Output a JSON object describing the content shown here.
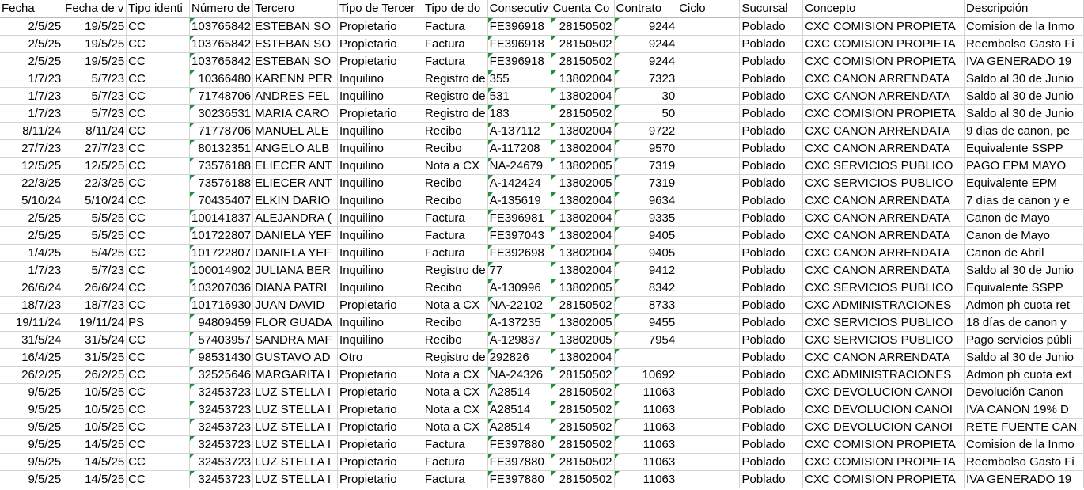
{
  "headers": [
    "Fecha",
    "Fecha de v",
    "Tipo identi",
    "Número de",
    "Tercero",
    "Tipo de Tercer",
    "Tipo de do",
    "Consecutiv",
    "Cuenta Co",
    "Contrato",
    "Ciclo",
    "Sucursal",
    "Concepto",
    "Descripción"
  ],
  "rows": [
    [
      "2/5/25",
      "19/5/25",
      "CC",
      "103765842",
      "ESTEBAN SO",
      "Propietario",
      "Factura",
      "FE396918",
      "28150502",
      "9244",
      "",
      "Poblado",
      "CXC COMISION PROPIETA",
      "Comision de la Inmo"
    ],
    [
      "2/5/25",
      "19/5/25",
      "CC",
      "103765842",
      "ESTEBAN SO",
      "Propietario",
      "Factura",
      "FE396918",
      "28150502",
      "9244",
      "",
      "Poblado",
      "CXC COMISION PROPIETA",
      "Reembolso Gasto Fi"
    ],
    [
      "2/5/25",
      "19/5/25",
      "CC",
      "103765842",
      "ESTEBAN SO",
      "Propietario",
      "Factura",
      "FE396918",
      "28150502",
      "9244",
      "",
      "Poblado",
      "CXC COMISION PROPIETA",
      "IVA GENERADO 19"
    ],
    [
      "1/7/23",
      "5/7/23",
      "CC",
      "10366480",
      "KARENN PER",
      "Inquilino",
      "Registro de",
      "355",
      "13802004",
      "7323",
      "",
      "Poblado",
      "CXC CANON ARRENDATA",
      "Saldo al 30 de Junio"
    ],
    [
      "1/7/23",
      "5/7/23",
      "CC",
      "71748706",
      "ANDRES FEL",
      "Inquilino",
      "Registro de",
      "531",
      "13802004",
      "30",
      "",
      "Poblado",
      "CXC CANON ARRENDATA",
      "Saldo al 30 de Junio"
    ],
    [
      "1/7/23",
      "5/7/23",
      "CC",
      "30236531",
      "MARIA CARO",
      "Propietario",
      "Registro de",
      "183",
      "28150502",
      "50",
      "",
      "Poblado",
      "CXC COMISION PROPIETA",
      "Saldo al 30 de Junio"
    ],
    [
      "8/11/24",
      "8/11/24",
      "CC",
      "71778706",
      "MANUEL ALE",
      "Inquilino",
      "Recibo",
      "A-137112",
      "13802004",
      "9722",
      "",
      "Poblado",
      "CXC CANON ARRENDATA",
      "9 dias de canon, pe"
    ],
    [
      "27/7/23",
      "27/7/23",
      "CC",
      "80132351",
      "ANGELO ALB",
      "Inquilino",
      "Recibo",
      "A-117208",
      "13802004",
      "9570",
      "",
      "Poblado",
      "CXC CANON ARRENDATA",
      "Equivalente SSPP"
    ],
    [
      "12/5/25",
      "12/5/25",
      "CC",
      "73576188",
      "ELIECER ANT",
      "Inquilino",
      "Nota a CX",
      "NA-24679",
      "13802005",
      "7319",
      "",
      "Poblado",
      "CXC SERVICIOS PUBLICO",
      "PAGO EPM MAYO"
    ],
    [
      "22/3/25",
      "22/3/25",
      "CC",
      "73576188",
      "ELIECER ANT",
      "Inquilino",
      "Recibo",
      "A-142424",
      "13802005",
      "7319",
      "",
      "Poblado",
      "CXC SERVICIOS PUBLICO",
      "Equivalente EPM"
    ],
    [
      "5/10/24",
      "5/10/24",
      "CC",
      "70435407",
      "ELKIN DARIO",
      "Inquilino",
      "Recibo",
      "A-135619",
      "13802004",
      "9634",
      "",
      "Poblado",
      "CXC CANON ARRENDATA",
      "7 días de canon y e"
    ],
    [
      "2/5/25",
      "5/5/25",
      "CC",
      "100141837",
      "ALEJANDRA (",
      "Inquilino",
      "Factura",
      "FE396981",
      "13802004",
      "9335",
      "",
      "Poblado",
      "CXC CANON ARRENDATA",
      "Canon  de Mayo"
    ],
    [
      "2/5/25",
      "5/5/25",
      "CC",
      "101722807",
      "DANIELA YEF",
      "Inquilino",
      "Factura",
      "FE397043",
      "13802004",
      "9405",
      "",
      "Poblado",
      "CXC CANON ARRENDATA",
      "Canon  de Mayo"
    ],
    [
      "1/4/25",
      "5/4/25",
      "CC",
      "101722807",
      "DANIELA YEF",
      "Inquilino",
      "Factura",
      "FE392698",
      "13802004",
      "9405",
      "",
      "Poblado",
      "CXC CANON ARRENDATA",
      "Canon  de Abril"
    ],
    [
      "1/7/23",
      "5/7/23",
      "CC",
      "100014902",
      "JULIANA BER",
      "Inquilino",
      "Registro de",
      "77",
      "13802004",
      "9412",
      "",
      "Poblado",
      "CXC CANON ARRENDATA",
      "Saldo al 30 de Junio"
    ],
    [
      "26/6/24",
      "26/6/24",
      "CC",
      "103207036",
      "DIANA PATRI",
      "Inquilino",
      "Recibo",
      "A-130996",
      "13802005",
      "8342",
      "",
      "Poblado",
      "CXC SERVICIOS PUBLICO",
      "Equivalente SSPP"
    ],
    [
      "18/7/23",
      "18/7/23",
      "CC",
      "101716930",
      "JUAN DAVID",
      "Propietario",
      "Nota a CX",
      "NA-22102",
      "28150502",
      "8733",
      "",
      "Poblado",
      "CXC ADMINISTRACIONES",
      "Admon ph cuota ret"
    ],
    [
      "19/11/24",
      "19/11/24",
      "PS",
      "94809459",
      "FLOR GUADA",
      "Inquilino",
      "Recibo",
      "A-137235",
      "13802005",
      "9455",
      "",
      "Poblado",
      "CXC SERVICIOS PUBLICO",
      "18 días de canon y"
    ],
    [
      "31/5/24",
      "31/5/24",
      "CC",
      "57403957",
      "SANDRA MAF",
      "Inquilino",
      "Recibo",
      "A-129837",
      "13802005",
      "7954",
      "",
      "Poblado",
      "CXC SERVICIOS PUBLICO",
      "Pago servicios públi"
    ],
    [
      "16/4/25",
      "31/5/25",
      "CC",
      "98531430",
      "GUSTAVO AD",
      "Otro",
      "Registro de",
      "292826",
      "13802004",
      "",
      "",
      "Poblado",
      "CXC CANON ARRENDATA",
      "Saldo al 30 de Junio"
    ],
    [
      "26/2/25",
      "26/2/25",
      "CC",
      "32525646",
      "MARGARITA I",
      "Propietario",
      "Nota a CX",
      "NA-24326",
      "28150502",
      "10692",
      "",
      "Poblado",
      "CXC ADMINISTRACIONES",
      "Admon ph cuota ext"
    ],
    [
      "9/5/25",
      "10/5/25",
      "CC",
      "32453723",
      "LUZ STELLA I",
      "Propietario",
      "Nota a CX",
      "A28514",
      "28150502",
      "11063",
      "",
      "Poblado",
      "CXC DEVOLUCION CANOI",
      "Devolución Canon"
    ],
    [
      "9/5/25",
      "10/5/25",
      "CC",
      "32453723",
      "LUZ STELLA I",
      "Propietario",
      "Nota a CX",
      "A28514",
      "28150502",
      "11063",
      "",
      "Poblado",
      "CXC DEVOLUCION CANOI",
      "IVA CANON 19% D"
    ],
    [
      "9/5/25",
      "10/5/25",
      "CC",
      "32453723",
      "LUZ STELLA I",
      "Propietario",
      "Nota a CX",
      "A28514",
      "28150502",
      "11063",
      "",
      "Poblado",
      "CXC DEVOLUCION CANOI",
      "RETE FUENTE CAN"
    ],
    [
      "9/5/25",
      "14/5/25",
      "CC",
      "32453723",
      "LUZ STELLA I",
      "Propietario",
      "Factura",
      "FE397880",
      "28150502",
      "11063",
      "",
      "Poblado",
      "CXC COMISION PROPIETA",
      "Comision de la Inmo"
    ],
    [
      "9/5/25",
      "14/5/25",
      "CC",
      "32453723",
      "LUZ STELLA I",
      "Propietario",
      "Factura",
      "FE397880",
      "28150502",
      "11063",
      "",
      "Poblado",
      "CXC COMISION PROPIETA",
      "Reembolso Gasto Fi"
    ],
    [
      "9/5/25",
      "14/5/25",
      "CC",
      "32453723",
      "LUZ STELLA I",
      "Propietario",
      "Factura",
      "FE397880",
      "28150502",
      "11063",
      "",
      "Poblado",
      "CXC COMISION PROPIETA",
      "IVA GENERADO 19"
    ]
  ]
}
